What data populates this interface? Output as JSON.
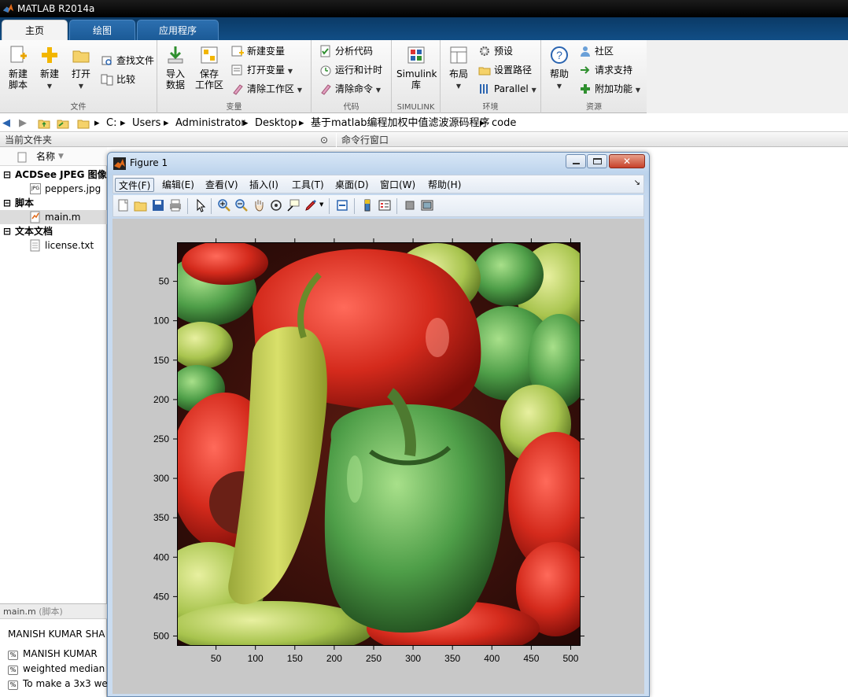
{
  "app": {
    "title": "MATLAB R2014a"
  },
  "tabs": [
    "主页",
    "绘图",
    "应用程序"
  ],
  "ribbon": {
    "file": {
      "group": "文件",
      "new_script": "新建\n脚本",
      "new": "新建",
      "open": "打开",
      "find_files": "查找文件",
      "compare": "比较"
    },
    "variable": {
      "group": "变量",
      "import": "导入\n数据",
      "save": "保存\n工作区",
      "new_var": "新建变量",
      "open_var": "打开变量",
      "clear_ws": "清除工作区"
    },
    "code": {
      "group": "代码",
      "analyze": "分析代码",
      "run_time": "运行和计时",
      "clear_cmd": "清除命令"
    },
    "simulink": {
      "group": "SIMULINK",
      "lib": "Simulink\n库"
    },
    "env": {
      "group": "环境",
      "layout": "布局",
      "prefs": "预设",
      "set_path": "设置路径",
      "parallel": "Parallel"
    },
    "resources": {
      "group": "资源",
      "help": "帮助",
      "community": "社区",
      "support": "请求支持",
      "addons": "附加功能"
    }
  },
  "address": [
    "C:",
    "Users",
    "Administrator",
    "Desktop",
    "基于matlab编程加权中值滤波源码程序",
    "code"
  ],
  "current_folder": {
    "title": "当前文件夹",
    "col_name": "名称",
    "groups": [
      {
        "label": "ACDSee JPEG 图像",
        "files": [
          "peppers.jpg"
        ]
      },
      {
        "label": "脚本",
        "files": [
          "main.m"
        ]
      },
      {
        "label": "文本文档",
        "files": [
          "license.txt"
        ]
      }
    ]
  },
  "details": {
    "title": "main.m",
    "subtitle": "(脚本)",
    "heading": "MANISH KUMAR SHA",
    "lines": [
      "MANISH KUMAR",
      "weighted median",
      "To make a 3x3 we"
    ]
  },
  "command_window": {
    "title": "命令行窗口"
  },
  "figure": {
    "title": "Figure 1",
    "menus": [
      "文件(F)",
      "编辑(E)",
      "查看(V)",
      "插入(I)",
      "工具(T)",
      "桌面(D)",
      "窗口(W)",
      "帮助(H)"
    ],
    "x_ticks": [
      50,
      100,
      150,
      200,
      250,
      300,
      350,
      400,
      450,
      500
    ],
    "y_ticks": [
      50,
      100,
      150,
      200,
      250,
      300,
      350,
      400,
      450,
      500
    ],
    "x_range": [
      0.5,
      512.5
    ],
    "y_range": [
      0.5,
      512.5
    ]
  },
  "colors": {
    "tab_bar": "#114e86",
    "figure_bg": "#c8c8c8"
  }
}
